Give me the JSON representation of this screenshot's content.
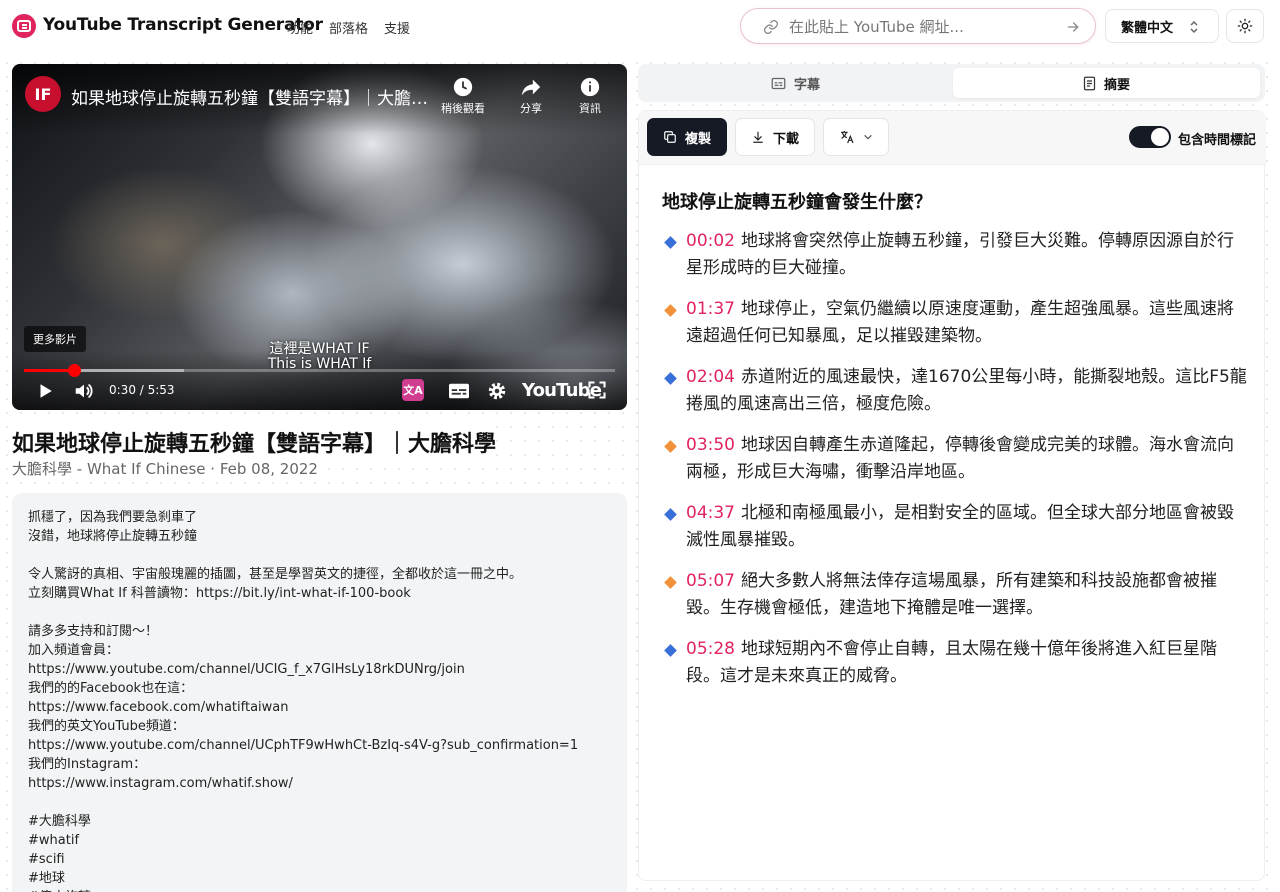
{
  "header": {
    "brand": "YouTube Transcript Generator",
    "nav": [
      "功能",
      "部落格",
      "支援"
    ],
    "url_placeholder": "在此貼上 YouTube 網址...",
    "language": "繁體中文"
  },
  "player": {
    "channel_logo": "IF",
    "title": "如果地球停止旋轉五秒鐘【雙語字幕】｜大膽科學",
    "watch_later": "稍後觀看",
    "share": "分享",
    "info": "資訊",
    "more_videos": "更多影片",
    "caption_zh": "這裡是WHAT IF",
    "caption_en": "This is WHAT If",
    "time": "0:30 / 5:53",
    "brand_word": "YouTube",
    "played_fraction": 0.085,
    "loaded_fraction": 0.27
  },
  "video": {
    "title": "如果地球停止旋轉五秒鐘【雙語字幕】｜大膽科學",
    "meta": "大膽科學 - What If Chinese · Feb 08, 2022"
  },
  "description_lines": [
    "抓穩了，因為我們要急刹車了",
    "沒錯，地球將停止旋轉五秒鐘",
    "",
    "令人驚訝的真相、宇宙般瑰麗的插圖，甚至是學習英文的捷徑，全都收於這一冊之中。",
    "立刻購買What If 科普讀物：https://bit.ly/int-what-if-100-book",
    "",
    "請多多支持和訂閱～！",
    "加入頻道會員：",
    "https://www.youtube.com/channel/UCIG_f_x7GlHsLy18rkDUNrg/join",
    "我們的的Facebook也在這：",
    "https://www.facebook.com/whatiftaiwan",
    "我們的英文YouTube頻道：",
    "https://www.youtube.com/channel/UCphTF9wHwhCt-BzIq-s4V-g?sub_confirmation=1",
    "我們的Instagram：",
    "https://www.instagram.com/whatif.show/",
    "",
    "#大膽科學",
    "#whatif",
    "#scifi",
    "#地球",
    "#停止旋轉"
  ],
  "tabs": {
    "subtitles": "字幕",
    "summary": "摘要"
  },
  "toolbar": {
    "copy": "複製",
    "download": "下載",
    "timestamps_label": "包含時間標記",
    "timestamps_on": true
  },
  "summary": {
    "title": "地球停止旋轉五秒鐘會發生什麼？",
    "items": [
      {
        "time": "00:02",
        "text": "地球將會突然停止旋轉五秒鐘，引發巨大災難。停轉原因源自於行星形成時的巨大碰撞。",
        "color": "#3b6fd8"
      },
      {
        "time": "01:37",
        "text": "地球停止，空氣仍繼續以原速度運動，產生超強風暴。這些風速將遠超過任何已知暴風，足以摧毀建築物。",
        "color": "#f0923a"
      },
      {
        "time": "02:04",
        "text": "赤道附近的風速最快，達1670公里每小時，能撕裂地殼。這比F5龍捲風的風速高出三倍，極度危險。",
        "color": "#3b6fd8"
      },
      {
        "time": "03:50",
        "text": "地球因自轉產生赤道隆起，停轉後會變成完美的球體。海水會流向兩極，形成巨大海嘯，衝擊沿岸地區。",
        "color": "#f0923a"
      },
      {
        "time": "04:37",
        "text": "北極和南極風最小，是相對安全的區域。但全球大部分地區會被毀滅性風暴摧毀。",
        "color": "#3b6fd8"
      },
      {
        "time": "05:07",
        "text": "絕大多數人將無法倖存這場風暴，所有建築和科技設施都會被摧毀。生存機會極低，建造地下掩體是唯一選擇。",
        "color": "#f0923a"
      },
      {
        "time": "05:28",
        "text": "地球短期內不會停止自轉，且太陽在幾十億年後將進入紅巨星階段。這才是未來真正的威脅。",
        "color": "#3b6fd8"
      }
    ]
  },
  "colors": {
    "accent": "#e0245e",
    "dark": "#151a24"
  }
}
